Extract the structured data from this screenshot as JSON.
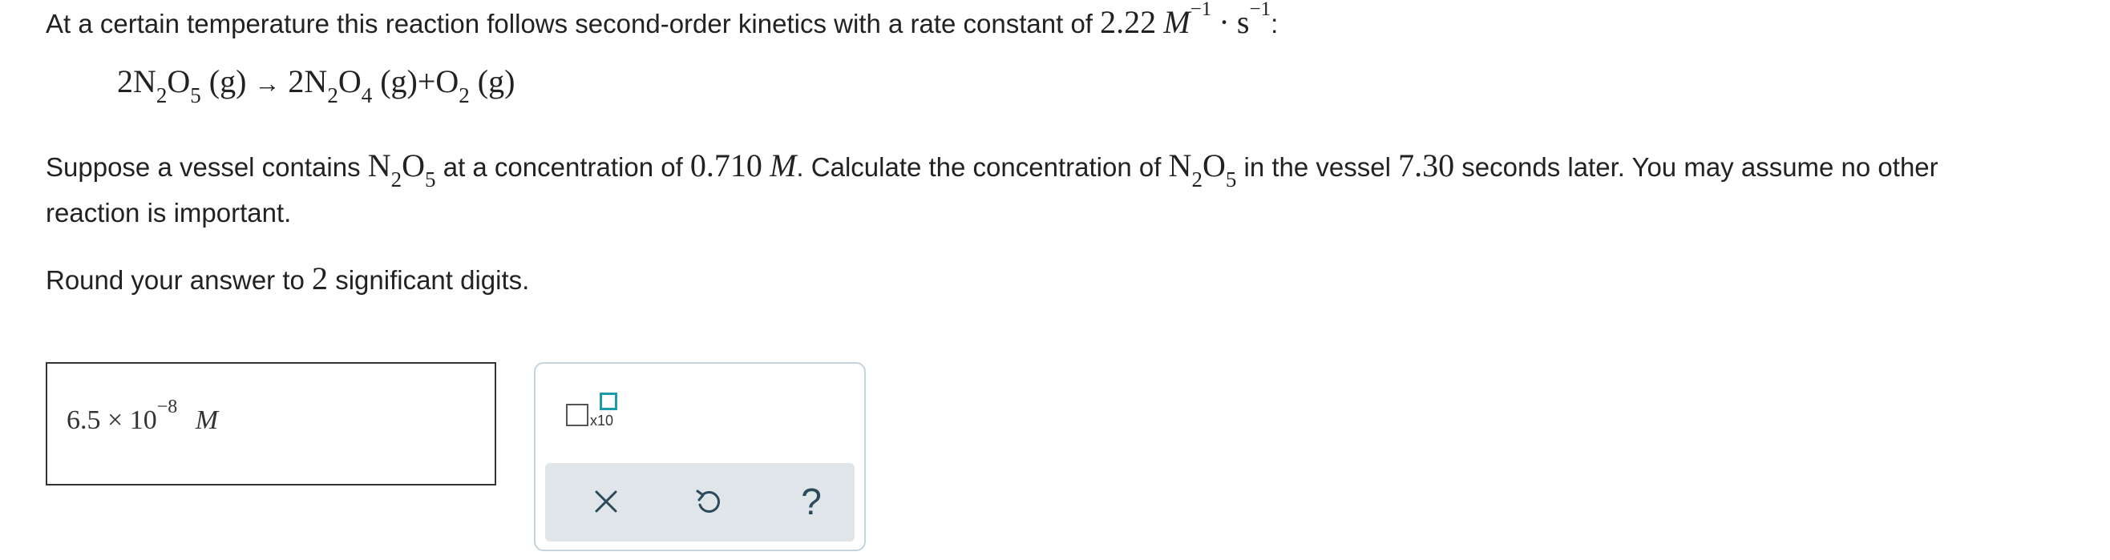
{
  "question": {
    "intro": "At a certain temperature this reaction follows second-order kinetics with a rate constant of",
    "rate_constant": "2.22",
    "unit_M": "M",
    "exp1": "−1",
    "dot": "·",
    "unit_s": "s",
    "exp2": "−1",
    "colon": ":",
    "equation": {
      "coef1": "2N",
      "sub1": "2",
      "o1": "O",
      "sub2": "5",
      "state1": "(g)",
      "arrow": "→",
      "coef2": "2N",
      "sub3": "2",
      "o2": "O",
      "sub4": "4",
      "state2": "(g)",
      "plus": "+",
      "o3": "O",
      "sub5": "2",
      "state3": "(g)"
    },
    "p2_a": "Suppose a vessel contains",
    "p2_b": "at a concentration of",
    "conc": "0.710",
    "p2_c": ". Calculate the concentration of",
    "p2_d": "in the vessel",
    "time": "7.30",
    "p2_e": "seconds later. You may assume no other",
    "p2_line2": "reaction is important.",
    "species_N": "N",
    "species_sub_n": "2",
    "species_O": "O",
    "species_sub_o": "5",
    "p3_a": "Round your answer to",
    "sigfigs": "2",
    "p3_b": "significant digits."
  },
  "answer": {
    "mantissa": "6.5",
    "times": "×",
    "base": "10",
    "exponent": "−8",
    "unit": "M"
  },
  "toolbar": {
    "x10_label": "x10",
    "clear_symbol": "×",
    "help_symbol": "?"
  },
  "colors": {
    "icon": "#2b4a5c",
    "panel_border": "#c5d3dc",
    "action_bar": "#dfe5e9",
    "accent": "#1a9aac"
  }
}
